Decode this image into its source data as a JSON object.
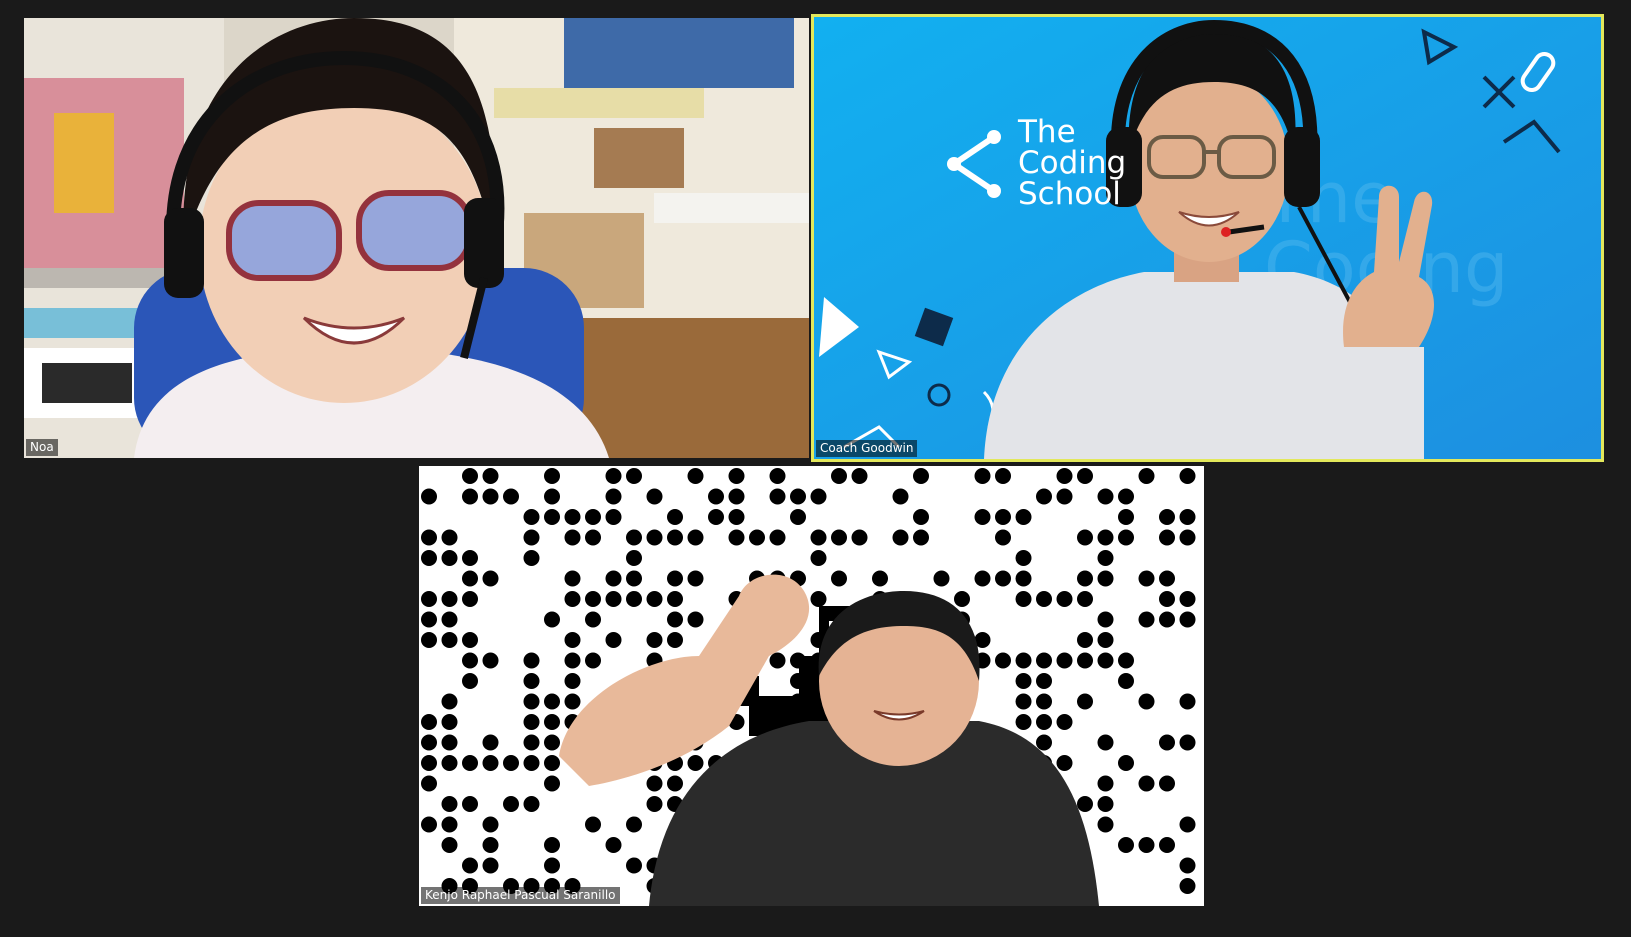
{
  "participants": [
    {
      "name": "Noa",
      "active_speaker": false
    },
    {
      "name": "Coach Goodwin",
      "active_speaker": true
    },
    {
      "name": "Kenjo Raphael Pascual Saranillo",
      "active_speaker": false
    }
  ],
  "background_brand": {
    "line1": "The",
    "line2": "Coding",
    "line3": "School"
  },
  "colors": {
    "app_background": "#1a1a1a",
    "active_speaker_border": "#e3e85b",
    "brand_background": "#1b9be6",
    "name_tag_background": "rgba(0,0,0,0.55)"
  }
}
